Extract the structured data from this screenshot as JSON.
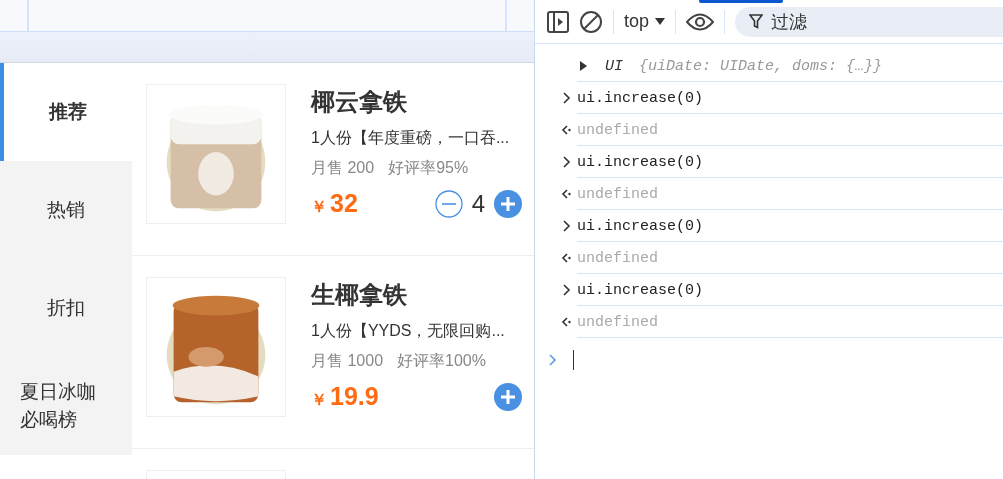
{
  "categories": [
    {
      "label": "推荐",
      "selected": true
    },
    {
      "label": "热销",
      "selected": false
    },
    {
      "label": "折扣",
      "selected": false
    },
    {
      "label": "夏日冰咖必喝榜",
      "selected": false
    }
  ],
  "products": [
    {
      "name": "椰云拿铁",
      "description": "1人份【年度重磅，一口吞...",
      "sales": "月售 200",
      "rating": "好评率95%",
      "currency": "￥",
      "price": "32",
      "count": "4"
    },
    {
      "name": "生椰拿铁",
      "description": "1人份【YYDS，无限回购...",
      "sales": "月售 1000",
      "rating": "好评率100%",
      "currency": "￥",
      "price": "19.9"
    }
  ],
  "devtools": {
    "context": "top",
    "filter_placeholder": "过滤",
    "console": [
      {
        "kind": "object",
        "label": "UI",
        "preview": "{uiDate: UIDate, doms: {…}}"
      },
      {
        "kind": "input",
        "text": "ui.increase(0)"
      },
      {
        "kind": "result",
        "text": "undefined"
      },
      {
        "kind": "input",
        "text": "ui.increase(0)"
      },
      {
        "kind": "result",
        "text": "undefined"
      },
      {
        "kind": "input",
        "text": "ui.increase(0)"
      },
      {
        "kind": "result",
        "text": "undefined"
      },
      {
        "kind": "input",
        "text": "ui.increase(0)"
      },
      {
        "kind": "result",
        "text": "undefined"
      },
      {
        "kind": "prompt"
      }
    ]
  }
}
